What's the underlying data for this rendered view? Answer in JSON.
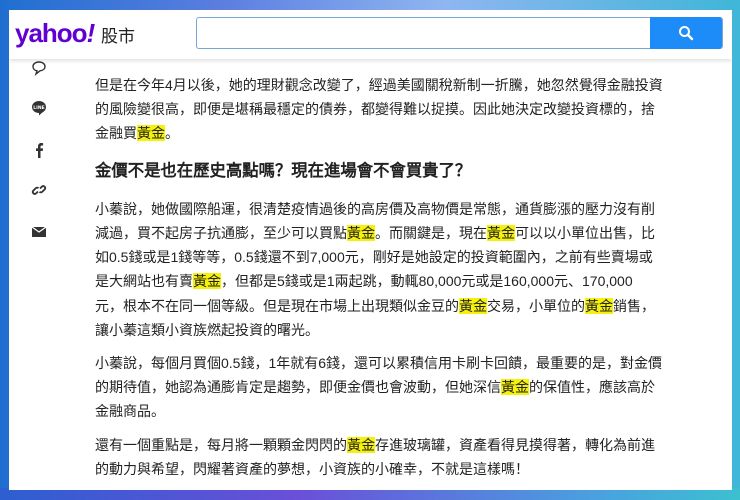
{
  "header": {
    "logo": "yahoo",
    "logo_bang": "!",
    "section": "股市",
    "search_placeholder": "",
    "search_icon": "search-icon"
  },
  "sidebar": {
    "icons": [
      "comment-icon",
      "line-icon",
      "facebook-icon",
      "link-icon",
      "mail-icon"
    ]
  },
  "colors": {
    "brand": "#6001d2",
    "search_button": "#1d8cf8",
    "highlight": "#f6f10a"
  },
  "article": {
    "paragraphs": [
      {
        "type": "p",
        "lines": [
          [
            {
              "t": "但是在今年4月以後，她的理財觀念改變了，經過美國關稅新制一折騰，她忽然覺得金融投資"
            }
          ],
          [
            {
              "t": "的風險變很高，即便是堪稱最穩定的債券，都變得難以捉摸。因此她決定改變投資標的，捨"
            }
          ],
          [
            {
              "t": "金融買"
            },
            {
              "t": "黃金",
              "hl": true
            },
            {
              "t": "。"
            }
          ]
        ]
      },
      {
        "type": "h",
        "lines": [
          [
            {
              "t": "金價不是也在歷史高點嗎？現在進場會不會買貴了？"
            }
          ]
        ]
      },
      {
        "type": "p",
        "lines": [
          [
            {
              "t": "小蓁說，她做國際船運，很清楚疫情過後的高房價及高物價是常態，通貨膨漲的壓力沒有削"
            }
          ],
          [
            {
              "t": "減過，買不起房子抗通膨，至少可以買點"
            },
            {
              "t": "黃金",
              "hl": true
            },
            {
              "t": "。而關鍵是，現在"
            },
            {
              "t": "黃金",
              "hl": true
            },
            {
              "t": "可以以小單位出售，比"
            }
          ],
          [
            {
              "t": "如0.5錢或是1錢等等，0.5錢還不到7,000元，剛好是她設定的投資範圍內，之前有些賣場或"
            }
          ],
          [
            {
              "t": "是大網站也有賣"
            },
            {
              "t": "黃金",
              "hl": true
            },
            {
              "t": "，但都是5錢或是1兩起跳，動輒80,000元或是160,000元、170,000"
            }
          ],
          [
            {
              "t": "元，根本不在同一個等級。但是現在市場上出現類似金豆的"
            },
            {
              "t": "黃金",
              "hl": true
            },
            {
              "t": "交易，小單位的"
            },
            {
              "t": "黃金",
              "hl": true
            },
            {
              "t": "銷售，"
            }
          ],
          [
            {
              "t": "讓小蓁這類小資族燃起投資的曙光。"
            }
          ]
        ]
      },
      {
        "type": "p",
        "lines": [
          [
            {
              "t": "小蓁說，每個月買個0.5錢，1年就有6錢，還可以累積信用卡刷卡回饋，最重要的是，對金價"
            }
          ],
          [
            {
              "t": "的期待值，她認為通膨肯定是趨勢，即便金價也會波動，但她深信"
            },
            {
              "t": "黃金",
              "hl": true
            },
            {
              "t": "的保值性，應該高於"
            }
          ],
          [
            {
              "t": "金融商品。"
            }
          ]
        ]
      },
      {
        "type": "p",
        "lines": [
          [
            {
              "t": "還有一個重點是，每月將一顆顆金閃閃的"
            },
            {
              "t": "黃金",
              "hl": true
            },
            {
              "t": "存進玻璃罐，資產看得見摸得著，轉化為前進"
            }
          ],
          [
            {
              "t": "的動力與希望，閃耀著資產的夢想，小資族的小確幸，不就是這樣嗎！"
            }
          ]
        ]
      }
    ]
  }
}
